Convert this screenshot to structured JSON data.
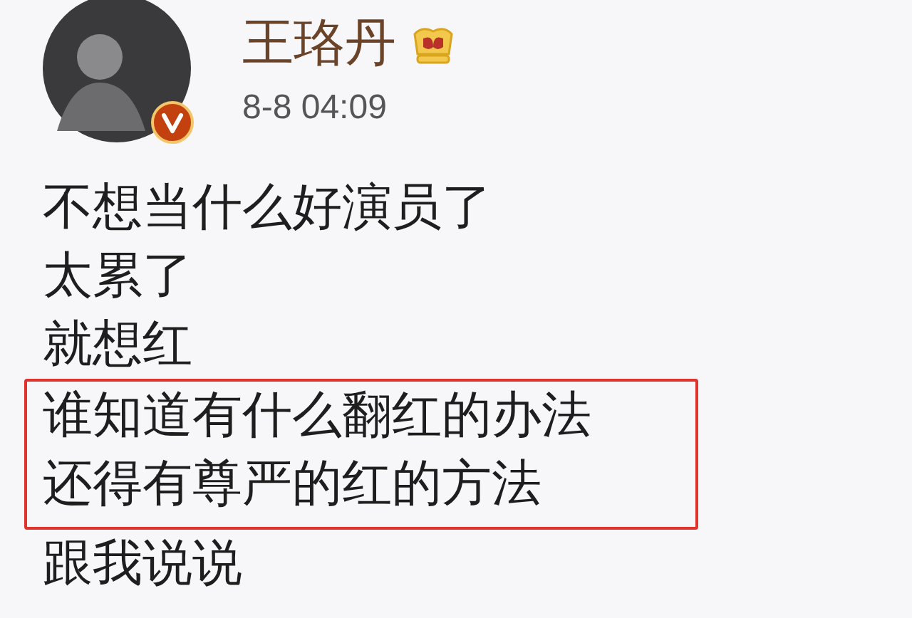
{
  "post": {
    "author": {
      "name": "王珞丹",
      "verified": true,
      "crown_badge": true
    },
    "time": "8-8 04:09",
    "lines": [
      {
        "text": "不想当什么好演员了",
        "highlighted": false
      },
      {
        "text": "太累了",
        "highlighted": false
      },
      {
        "text": "就想红",
        "highlighted": false
      },
      {
        "text": "谁知道有什么翻红的办法",
        "highlighted": true
      },
      {
        "text": "还得有尊严的红的方法",
        "highlighted": true
      },
      {
        "text": "跟我说说",
        "highlighted": false
      }
    ]
  }
}
